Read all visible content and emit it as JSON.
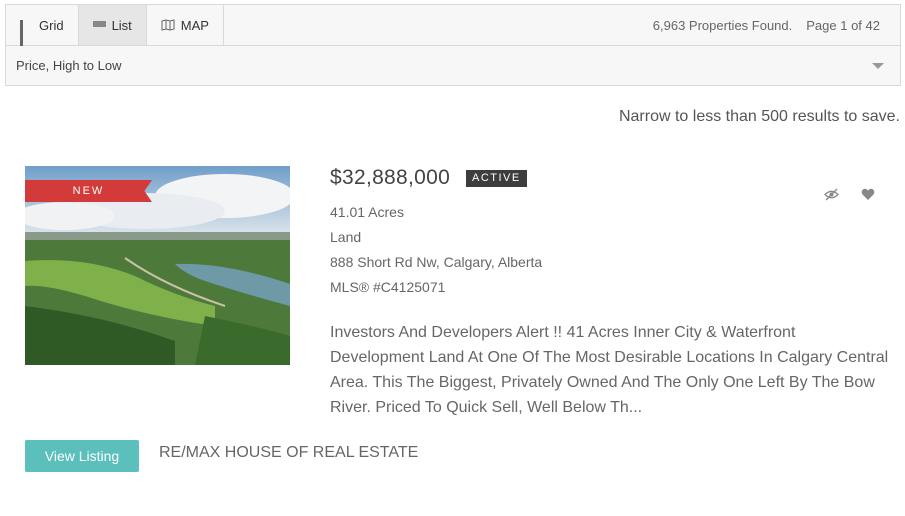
{
  "toolbar": {
    "tabs": [
      {
        "label": "Grid",
        "icon": "grid-icon",
        "active": false
      },
      {
        "label": "List",
        "icon": "list-icon",
        "active": true
      },
      {
        "label": "MAP",
        "icon": "map-icon",
        "active": false
      }
    ],
    "results_count": "6,963 Properties Found.",
    "page_info": "Page 1 of 42"
  },
  "sort": {
    "selected": "Price, High to Low"
  },
  "notice": "Narrow to less than 500 results to save.",
  "listing": {
    "badge": "NEW",
    "price": "$32,888,000",
    "status": "ACTIVE",
    "acres": "41.01 Acres",
    "type": "Land",
    "address": "888 Short Rd Nw, Calgary, Alberta",
    "mls": "MLS® #C4125071",
    "description": "Investors And Developers Alert !! 41 Acres Inner City & Waterfront Development Land At One Of The Most Desirable Locations In Calgary Central Area. This The Biggest, Privately Owned And The Only One Left By The Bow River. Priced To Quick Sell, Well Below Th...",
    "view_label": "View Listing",
    "brokerage": "RE/MAX HOUSE OF REAL ESTATE"
  },
  "colors": {
    "accent": "#5bbfbc",
    "ribbon": "#d33a3a",
    "status_bg": "#3d3d3d"
  }
}
